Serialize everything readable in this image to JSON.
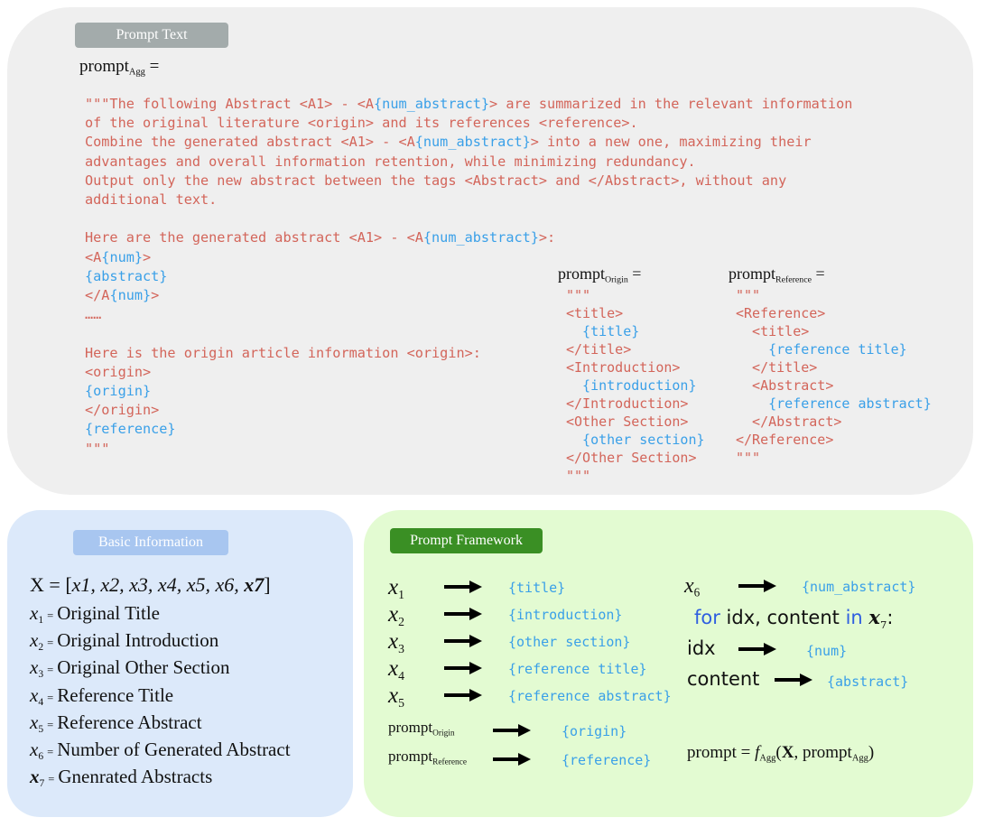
{
  "top": {
    "tag": "Prompt Text",
    "agg_label": {
      "base": "prompt",
      "sub": "Agg",
      "eq": " ="
    },
    "agg_lines": [
      [
        {
          "t": "\"\"\"The following Abstract <A1> - <A",
          "c": "red"
        },
        {
          "t": "{num_abstract}",
          "c": "blue"
        },
        {
          "t": "> are summarized in the relevant information",
          "c": "red"
        }
      ],
      [
        {
          "t": "of the original literature <origin> and its references <reference>.",
          "c": "red"
        }
      ],
      [
        {
          "t": "Combine the generated abstract <A1> - <A",
          "c": "red"
        },
        {
          "t": "{num_abstract}",
          "c": "blue"
        },
        {
          "t": "> into a new one, maximizing their",
          "c": "red"
        }
      ],
      [
        {
          "t": "advantages and overall information retention, while minimizing redundancy.",
          "c": "red"
        }
      ],
      [
        {
          "t": "Output only the new abstract between the tags <Abstract> and </Abstract>, without any",
          "c": "red"
        }
      ],
      [
        {
          "t": "additional text.",
          "c": "red"
        }
      ],
      [],
      [
        {
          "t": "Here are the generated abstract <A1> - <A",
          "c": "red"
        },
        {
          "t": "{num_abstract}",
          "c": "blue"
        },
        {
          "t": ">:",
          "c": "red"
        }
      ],
      [
        {
          "t": "<A",
          "c": "red"
        },
        {
          "t": "{num}",
          "c": "blue"
        },
        {
          "t": ">",
          "c": "red"
        }
      ],
      [
        {
          "t": "{abstract}",
          "c": "blue"
        }
      ],
      [
        {
          "t": "</A",
          "c": "red"
        },
        {
          "t": "{num}",
          "c": "blue"
        },
        {
          "t": ">",
          "c": "red"
        }
      ],
      [
        {
          "t": "……",
          "c": "red"
        }
      ],
      [],
      [
        {
          "t": "Here is the origin article information <origin>:",
          "c": "red"
        }
      ],
      [
        {
          "t": "<origin>",
          "c": "red"
        }
      ],
      [
        {
          "t": "{origin}",
          "c": "blue"
        }
      ],
      [
        {
          "t": "</origin>",
          "c": "red"
        }
      ],
      [
        {
          "t": "{reference}",
          "c": "blue"
        }
      ],
      [
        {
          "t": "\"\"\"",
          "c": "red"
        }
      ]
    ],
    "origin_label": {
      "base": "prompt",
      "sub": "Origin",
      "eq": " ="
    },
    "origin_lines": [
      [
        {
          "t": "\"\"\"",
          "c": "red"
        }
      ],
      [
        {
          "t": "<title>",
          "c": "red"
        }
      ],
      [
        {
          "t": "  {title}",
          "c": "blue"
        }
      ],
      [
        {
          "t": "</title>",
          "c": "red"
        }
      ],
      [
        {
          "t": "<Introduction>",
          "c": "red"
        }
      ],
      [
        {
          "t": "  {introduction}",
          "c": "blue"
        }
      ],
      [
        {
          "t": "</Introduction>",
          "c": "red"
        }
      ],
      [
        {
          "t": "<Other Section>",
          "c": "red"
        }
      ],
      [
        {
          "t": "  {other section}",
          "c": "blue"
        }
      ],
      [
        {
          "t": "</Other Section>",
          "c": "red"
        }
      ],
      [
        {
          "t": "\"\"\"",
          "c": "red"
        }
      ]
    ],
    "reference_label": {
      "base": "prompt",
      "sub": "Reference",
      "eq": " ="
    },
    "reference_lines": [
      [
        {
          "t": "\"\"\"",
          "c": "red"
        }
      ],
      [
        {
          "t": "<Reference>",
          "c": "red"
        }
      ],
      [
        {
          "t": "  <title>",
          "c": "red"
        }
      ],
      [
        {
          "t": "    {reference title}",
          "c": "blue"
        }
      ],
      [
        {
          "t": "  </title>",
          "c": "red"
        }
      ],
      [
        {
          "t": "  <Abstract>",
          "c": "red"
        }
      ],
      [
        {
          "t": "    {reference abstract}",
          "c": "blue"
        }
      ],
      [
        {
          "t": "  </Abstract>",
          "c": "red"
        }
      ],
      [
        {
          "t": "</Reference>",
          "c": "red"
        }
      ],
      [
        {
          "t": "\"\"\"",
          "c": "red"
        }
      ]
    ]
  },
  "basic": {
    "tag": "Basic Information",
    "x_def": {
      "lhs": "X",
      "eq": " = ",
      "open": "[",
      "items": "x1, x2, x3, x4, x5, x6, ",
      "bold": "x7",
      "close": "]"
    },
    "rows": [
      {
        "var": "x",
        "sub": "1",
        "text": "Original Title"
      },
      {
        "var": "x",
        "sub": "2",
        "text": "Original Introduction"
      },
      {
        "var": "x",
        "sub": "3",
        "text": "Original Other Section"
      },
      {
        "var": "x",
        "sub": "4",
        "text": "Reference Title"
      },
      {
        "var": "x",
        "sub": "5",
        "text": "Reference Abstract"
      },
      {
        "var": "x",
        "sub": "6",
        "text": "Number of Generated Abstract"
      },
      {
        "var": "x",
        "sub": "7",
        "text": "Gnenrated Abstracts"
      }
    ],
    "eq": "="
  },
  "framework": {
    "tag": "Prompt Framework",
    "left_maps": [
      {
        "var": "x",
        "sub": "1",
        "target": "{title}"
      },
      {
        "var": "x",
        "sub": "2",
        "target": "{introduction}"
      },
      {
        "var": "x",
        "sub": "3",
        "target": "{other section}"
      },
      {
        "var": "x",
        "sub": "4",
        "target": "{reference title}"
      },
      {
        "var": "x",
        "sub": "5",
        "target": "{reference abstract}"
      }
    ],
    "prompt_maps": [
      {
        "base": "prompt",
        "sub": "Origin",
        "target": "{origin}"
      },
      {
        "base": "prompt",
        "sub": "Reference",
        "target": "{reference}"
      }
    ],
    "x6": {
      "var": "x",
      "sub": "6",
      "target": "{num_abstract}"
    },
    "loop": {
      "kw_for": "for",
      "mid": " idx, content ",
      "kw_in": "in",
      "var": "x",
      "sub": "7",
      "colon": ":"
    },
    "idx": {
      "label": "idx",
      "target": "{num}"
    },
    "content": {
      "label": "content",
      "target": "{abstract}"
    },
    "formula": {
      "lhs": "prompt = ",
      "f": "f",
      "fsub": "Agg",
      "open": "(",
      "X": "X",
      "comma": ", prompt",
      "psub": "Agg",
      "close": ")"
    }
  },
  "colors": {
    "code_red": "#d3655a",
    "code_blue": "#3aa0e8",
    "keyword_blue": "#2f5fe0",
    "top_bg": "#efefef",
    "basic_bg": "#dce9fa",
    "framework_bg": "#e3fbd2",
    "tag_gray": "#a3abab",
    "tag_blue": "#a8c6f0",
    "tag_green": "#3a8f24"
  },
  "icons": [
    "right-arrow-icon"
  ]
}
